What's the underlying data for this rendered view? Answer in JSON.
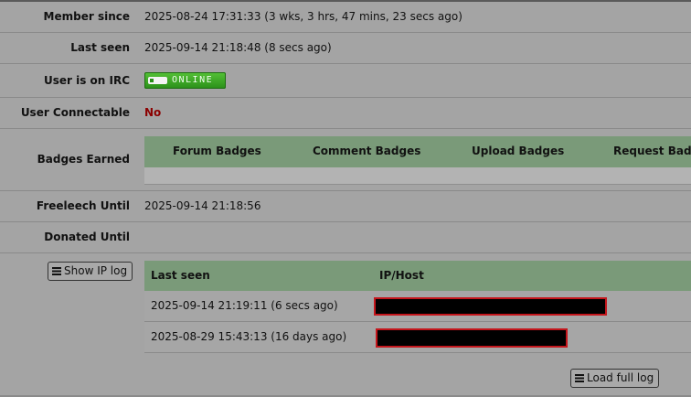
{
  "profile": {
    "member_since": {
      "label": "Member since",
      "value": "2025-08-24 17:31:33 (3 wks, 3 hrs, 47 mins, 23 secs ago)"
    },
    "last_seen": {
      "label": "Last seen",
      "value": "2025-09-14 21:18:48 (8 secs ago)"
    },
    "irc": {
      "label": "User is on IRC",
      "badge_text": "ONLINE",
      "badge_color": "#2a8f19"
    },
    "connectable": {
      "label": "User Connectable",
      "value": "No",
      "value_color": "#8b0000"
    },
    "badges": {
      "label": "Badges Earned",
      "tabs": [
        "Forum Badges",
        "Comment Badges",
        "Upload Badges",
        "Request Badges"
      ]
    },
    "freeleech": {
      "label": "Freeleech Until",
      "value": "2025-09-14 21:18:56"
    },
    "donated": {
      "label": "Donated Until",
      "value": ""
    }
  },
  "ip_log": {
    "show_button": "Show IP log",
    "columns": [
      "Last seen",
      "IP/Host"
    ],
    "rows": [
      {
        "last_seen": "2025-09-14 21:19:11 (6 secs ago)",
        "ip_host": "redacted"
      },
      {
        "last_seen": "2025-08-29 15:43:13 (16 days ago)",
        "ip_host": "redacted"
      }
    ],
    "load_button": "Load full log"
  },
  "colors": {
    "background": "#a4a4a4",
    "table_header": "#7a9a79",
    "redaction_border": "#c4161c"
  }
}
